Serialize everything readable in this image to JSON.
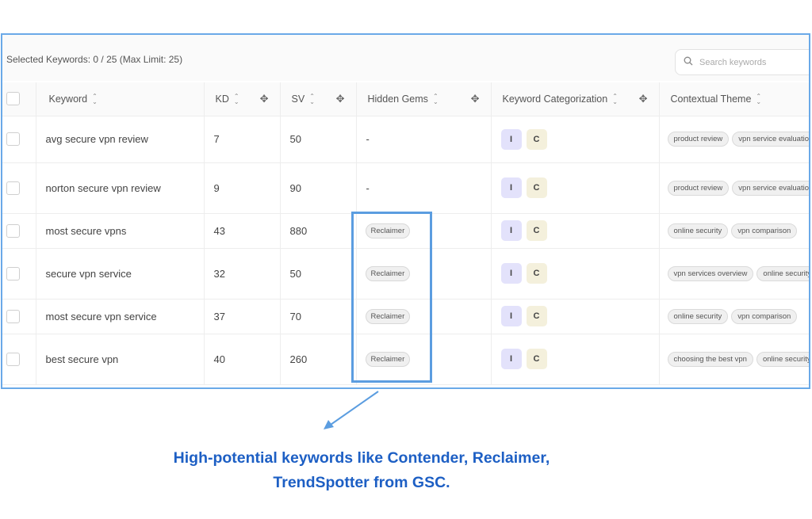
{
  "toolbar": {
    "selected_info": "Selected Keywords: 0 / 25 (Max Limit: 25)",
    "search_placeholder": "Search keywords"
  },
  "table": {
    "columns": [
      {
        "label": "Keyword",
        "sortable": true,
        "movable": false
      },
      {
        "label": "KD",
        "sortable": true,
        "movable": true
      },
      {
        "label": "SV",
        "sortable": true,
        "movable": true
      },
      {
        "label": "Hidden Gems",
        "sortable": true,
        "movable": true
      },
      {
        "label": "Keyword Categorization",
        "sortable": true,
        "movable": true
      },
      {
        "label": "Contextual Theme",
        "sortable": true,
        "movable": false
      }
    ],
    "rows": [
      {
        "keyword": "avg secure vpn review",
        "kd": "7",
        "sv": "50",
        "hidden_gem": "-",
        "cat_i": "I",
        "cat_c": "C",
        "themes": [
          "product review",
          "vpn service evaluation"
        ]
      },
      {
        "keyword": "norton secure vpn review",
        "kd": "9",
        "sv": "90",
        "hidden_gem": "-",
        "cat_i": "I",
        "cat_c": "C",
        "themes": [
          "product review",
          "vpn service evaluation"
        ]
      },
      {
        "keyword": "most secure vpns",
        "kd": "43",
        "sv": "880",
        "hidden_gem": "Reclaimer",
        "cat_i": "I",
        "cat_c": "C",
        "themes": [
          "online security",
          "vpn comparison"
        ]
      },
      {
        "keyword": "secure vpn service",
        "kd": "32",
        "sv": "50",
        "hidden_gem": "Reclaimer",
        "cat_i": "I",
        "cat_c": "C",
        "themes": [
          "vpn services overview",
          "online security"
        ]
      },
      {
        "keyword": "most secure vpn service",
        "kd": "37",
        "sv": "70",
        "hidden_gem": "Reclaimer",
        "cat_i": "I",
        "cat_c": "C",
        "themes": [
          "online security",
          "vpn comparison"
        ]
      },
      {
        "keyword": "best secure vpn",
        "kd": "40",
        "sv": "260",
        "hidden_gem": "Reclaimer",
        "cat_i": "I",
        "cat_c": "C",
        "themes": [
          "choosing the best vpn",
          "online security"
        ]
      }
    ]
  },
  "caption": {
    "line1": "High-potential keywords like Contender, Reclaimer,",
    "line2": "TrendSpotter from GSC."
  },
  "icons": {
    "search": "search-icon",
    "sort": "sort-icon",
    "move": "drag-move-icon"
  },
  "colors": {
    "frame_border": "#6aa9e8",
    "highlight_border": "#5b9de0",
    "caption_text": "#1d5fc4",
    "intent_badge": "#e3e2fb",
    "commercial_badge": "#f4f0dc"
  }
}
